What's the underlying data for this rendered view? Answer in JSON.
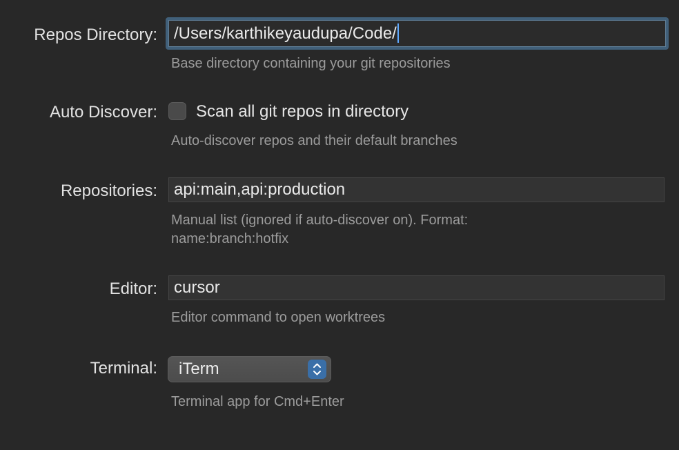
{
  "repos_directory": {
    "label": "Repos Directory:",
    "value": "/Users/karthikeyaudupa/Code/",
    "help": "Base directory containing your git repositories"
  },
  "auto_discover": {
    "label": "Auto Discover:",
    "checkbox_label": "Scan all git repos in directory",
    "checked": false,
    "help": "Auto-discover repos and their default branches"
  },
  "repositories": {
    "label": "Repositories:",
    "value": "api:main,api:production",
    "help_line1": "Manual list (ignored if auto-discover on). Format:",
    "help_line2": "name:branch:hotfix"
  },
  "editor": {
    "label": "Editor:",
    "value": "cursor",
    "help": "Editor command to open worktrees"
  },
  "terminal": {
    "label": "Terminal:",
    "selected": "iTerm",
    "help": "Terminal app for Cmd+Enter"
  },
  "colors": {
    "background": "#282828",
    "accent": "#3a6fa8",
    "focus_ring": "#41607a"
  }
}
